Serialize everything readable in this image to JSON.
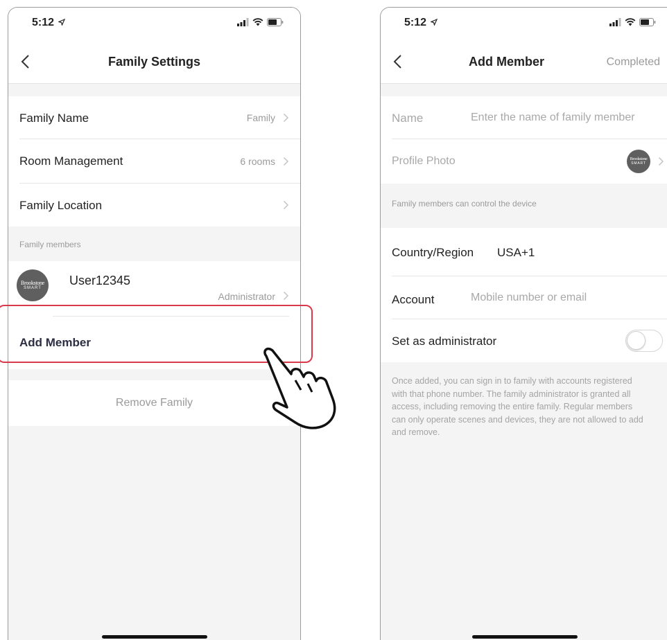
{
  "left_screen": {
    "status_time": "5:12",
    "nav_title": "Family Settings",
    "rows": {
      "family_name": {
        "label": "Family Name",
        "value": "Family"
      },
      "room_management": {
        "label": "Room Management",
        "value": "6 rooms"
      },
      "family_location": {
        "label": "Family Location",
        "value": ""
      }
    },
    "members_section_label": "Family members",
    "member": {
      "name": "User12345",
      "role": "Administrator",
      "avatar_brand_line1": "Brookstone",
      "avatar_brand_line2": "SMART"
    },
    "add_member_label": "Add Member",
    "remove_family_label": "Remove Family"
  },
  "right_screen": {
    "status_time": "5:12",
    "nav_title": "Add Member",
    "nav_action": "Completed",
    "name_label": "Name",
    "name_placeholder": "Enter the name of family member",
    "profile_photo_label": "Profile Photo",
    "avatar_brand_line1": "Brookstone",
    "avatar_brand_line2": "SMART",
    "control_note": "Family members can control the device",
    "country_label": "Country/Region",
    "country_value": "USA+1",
    "account_label": "Account",
    "account_placeholder": "Mobile number or email",
    "admin_label": "Set as administrator",
    "admin_enabled": false,
    "info_text": "Once added, you can sign in to family with accounts registered with that phone number. The family administrator is granted all access, including removing the entire family. Regular members can only operate scenes and devices, they are not allowed to add and remove."
  },
  "colors": {
    "highlight": "#d9394a",
    "secondary_text": "#9a9a9a",
    "background_gray": "#f4f4f4"
  },
  "icons": [
    "location-arrow-icon",
    "signal-icon",
    "wifi-icon",
    "battery-icon",
    "back-chevron-icon",
    "chevron-right-icon",
    "pointing-hand-icon"
  ]
}
